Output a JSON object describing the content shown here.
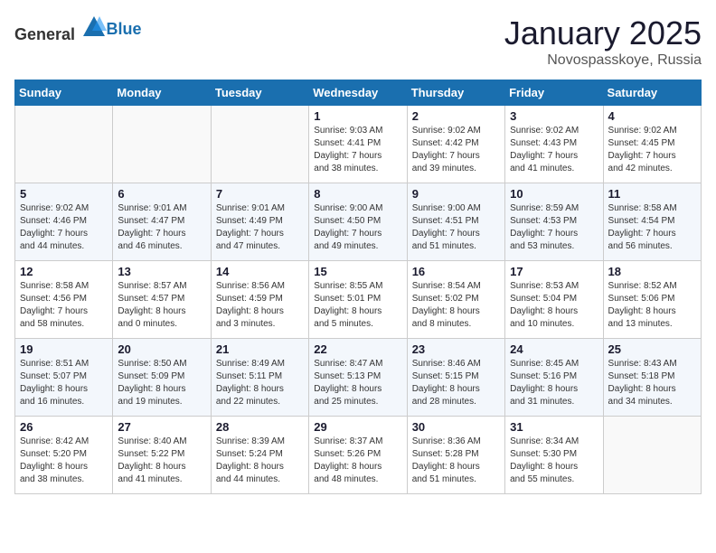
{
  "logo": {
    "general": "General",
    "blue": "Blue"
  },
  "title": "January 2025",
  "subtitle": "Novospasskoye, Russia",
  "weekdays": [
    "Sunday",
    "Monday",
    "Tuesday",
    "Wednesday",
    "Thursday",
    "Friday",
    "Saturday"
  ],
  "weeks": [
    [
      {
        "day": "",
        "info": ""
      },
      {
        "day": "",
        "info": ""
      },
      {
        "day": "",
        "info": ""
      },
      {
        "day": "1",
        "info": "Sunrise: 9:03 AM\nSunset: 4:41 PM\nDaylight: 7 hours\nand 38 minutes."
      },
      {
        "day": "2",
        "info": "Sunrise: 9:02 AM\nSunset: 4:42 PM\nDaylight: 7 hours\nand 39 minutes."
      },
      {
        "day": "3",
        "info": "Sunrise: 9:02 AM\nSunset: 4:43 PM\nDaylight: 7 hours\nand 41 minutes."
      },
      {
        "day": "4",
        "info": "Sunrise: 9:02 AM\nSunset: 4:45 PM\nDaylight: 7 hours\nand 42 minutes."
      }
    ],
    [
      {
        "day": "5",
        "info": "Sunrise: 9:02 AM\nSunset: 4:46 PM\nDaylight: 7 hours\nand 44 minutes."
      },
      {
        "day": "6",
        "info": "Sunrise: 9:01 AM\nSunset: 4:47 PM\nDaylight: 7 hours\nand 46 minutes."
      },
      {
        "day": "7",
        "info": "Sunrise: 9:01 AM\nSunset: 4:49 PM\nDaylight: 7 hours\nand 47 minutes."
      },
      {
        "day": "8",
        "info": "Sunrise: 9:00 AM\nSunset: 4:50 PM\nDaylight: 7 hours\nand 49 minutes."
      },
      {
        "day": "9",
        "info": "Sunrise: 9:00 AM\nSunset: 4:51 PM\nDaylight: 7 hours\nand 51 minutes."
      },
      {
        "day": "10",
        "info": "Sunrise: 8:59 AM\nSunset: 4:53 PM\nDaylight: 7 hours\nand 53 minutes."
      },
      {
        "day": "11",
        "info": "Sunrise: 8:58 AM\nSunset: 4:54 PM\nDaylight: 7 hours\nand 56 minutes."
      }
    ],
    [
      {
        "day": "12",
        "info": "Sunrise: 8:58 AM\nSunset: 4:56 PM\nDaylight: 7 hours\nand 58 minutes."
      },
      {
        "day": "13",
        "info": "Sunrise: 8:57 AM\nSunset: 4:57 PM\nDaylight: 8 hours\nand 0 minutes."
      },
      {
        "day": "14",
        "info": "Sunrise: 8:56 AM\nSunset: 4:59 PM\nDaylight: 8 hours\nand 3 minutes."
      },
      {
        "day": "15",
        "info": "Sunrise: 8:55 AM\nSunset: 5:01 PM\nDaylight: 8 hours\nand 5 minutes."
      },
      {
        "day": "16",
        "info": "Sunrise: 8:54 AM\nSunset: 5:02 PM\nDaylight: 8 hours\nand 8 minutes."
      },
      {
        "day": "17",
        "info": "Sunrise: 8:53 AM\nSunset: 5:04 PM\nDaylight: 8 hours\nand 10 minutes."
      },
      {
        "day": "18",
        "info": "Sunrise: 8:52 AM\nSunset: 5:06 PM\nDaylight: 8 hours\nand 13 minutes."
      }
    ],
    [
      {
        "day": "19",
        "info": "Sunrise: 8:51 AM\nSunset: 5:07 PM\nDaylight: 8 hours\nand 16 minutes."
      },
      {
        "day": "20",
        "info": "Sunrise: 8:50 AM\nSunset: 5:09 PM\nDaylight: 8 hours\nand 19 minutes."
      },
      {
        "day": "21",
        "info": "Sunrise: 8:49 AM\nSunset: 5:11 PM\nDaylight: 8 hours\nand 22 minutes."
      },
      {
        "day": "22",
        "info": "Sunrise: 8:47 AM\nSunset: 5:13 PM\nDaylight: 8 hours\nand 25 minutes."
      },
      {
        "day": "23",
        "info": "Sunrise: 8:46 AM\nSunset: 5:15 PM\nDaylight: 8 hours\nand 28 minutes."
      },
      {
        "day": "24",
        "info": "Sunrise: 8:45 AM\nSunset: 5:16 PM\nDaylight: 8 hours\nand 31 minutes."
      },
      {
        "day": "25",
        "info": "Sunrise: 8:43 AM\nSunset: 5:18 PM\nDaylight: 8 hours\nand 34 minutes."
      }
    ],
    [
      {
        "day": "26",
        "info": "Sunrise: 8:42 AM\nSunset: 5:20 PM\nDaylight: 8 hours\nand 38 minutes."
      },
      {
        "day": "27",
        "info": "Sunrise: 8:40 AM\nSunset: 5:22 PM\nDaylight: 8 hours\nand 41 minutes."
      },
      {
        "day": "28",
        "info": "Sunrise: 8:39 AM\nSunset: 5:24 PM\nDaylight: 8 hours\nand 44 minutes."
      },
      {
        "day": "29",
        "info": "Sunrise: 8:37 AM\nSunset: 5:26 PM\nDaylight: 8 hours\nand 48 minutes."
      },
      {
        "day": "30",
        "info": "Sunrise: 8:36 AM\nSunset: 5:28 PM\nDaylight: 8 hours\nand 51 minutes."
      },
      {
        "day": "31",
        "info": "Sunrise: 8:34 AM\nSunset: 5:30 PM\nDaylight: 8 hours\nand 55 minutes."
      },
      {
        "day": "",
        "info": ""
      }
    ]
  ]
}
